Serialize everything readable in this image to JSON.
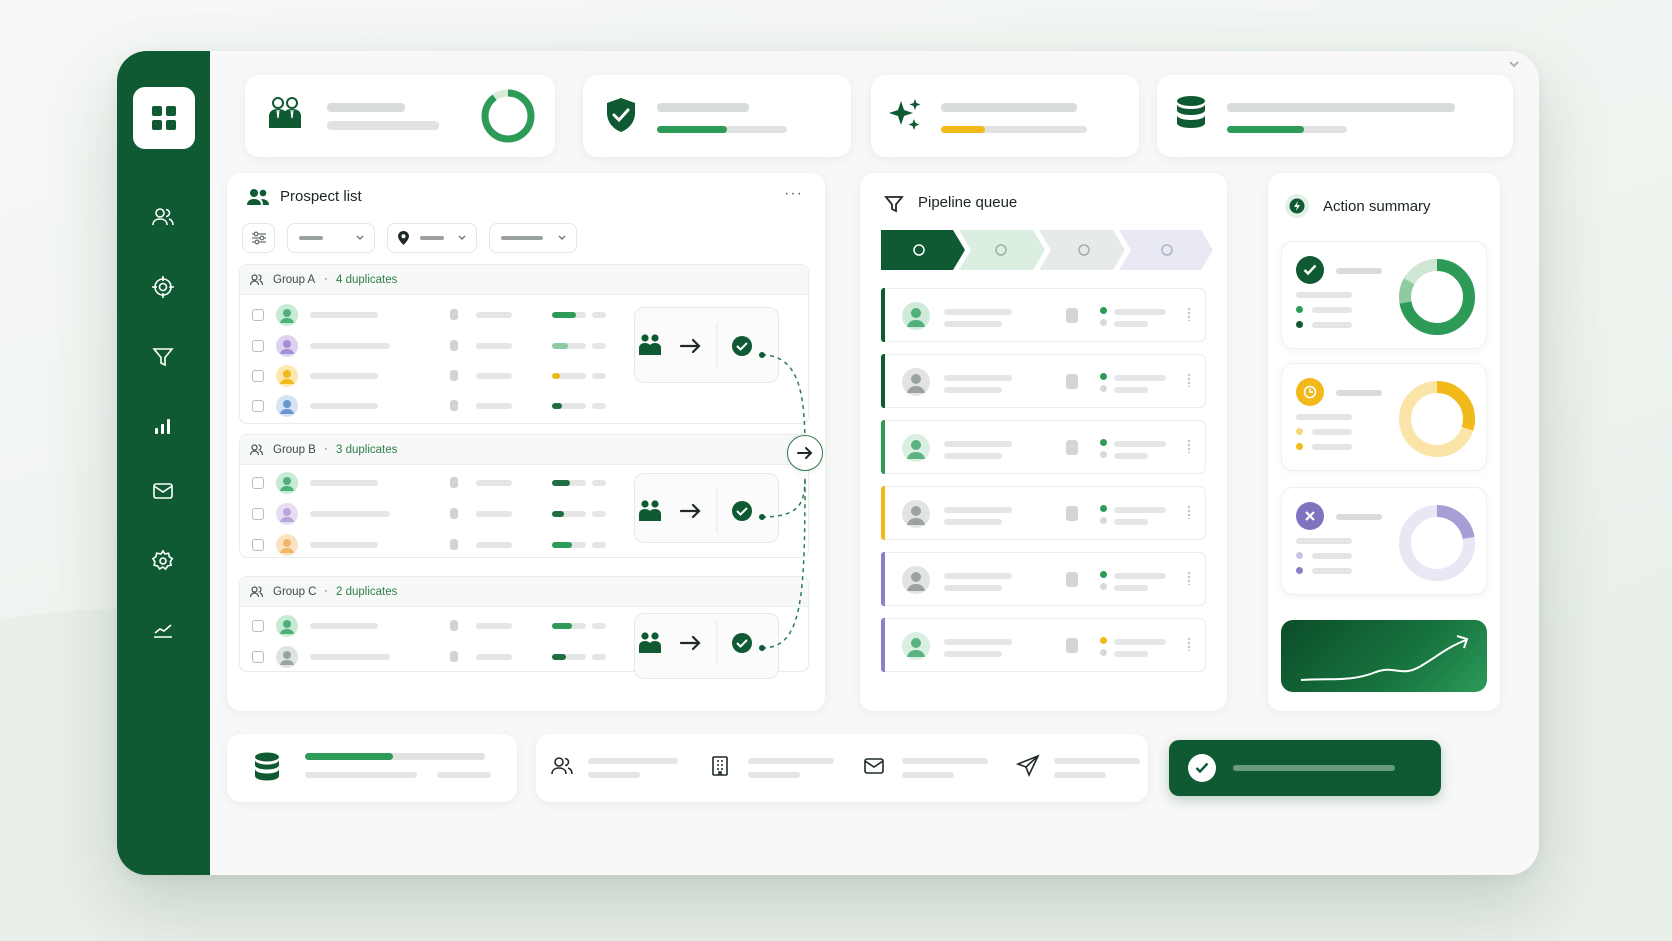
{
  "prospect_list": {
    "title": "Prospect list",
    "more": "···",
    "groups": [
      {
        "label": "Group A",
        "sep": "·",
        "count": "4 duplicates"
      },
      {
        "label": "Group B",
        "sep": "·",
        "count": "3 duplicates"
      },
      {
        "label": "Group C",
        "sep": "·",
        "count": "2 duplicates"
      }
    ]
  },
  "pipeline": {
    "title": "Pipeline queue"
  },
  "summary": {
    "title": "Action summary"
  },
  "colors": {
    "brand": "#0f5a32",
    "accent": "#2e9a58",
    "warning": "#f2b91b",
    "muted": "#8b7fc7"
  },
  "icons": [
    "grid-icon",
    "users-icon",
    "target-icon",
    "filter-icon",
    "bar-chart-icon",
    "mail-icon",
    "gear-icon",
    "trend-icon",
    "team-icon",
    "shield-icon",
    "sparkle-icon",
    "database-icon",
    "building-icon",
    "send-icon",
    "check-icon",
    "arrow-right-icon",
    "clock-icon",
    "close-icon",
    "map-pin-icon",
    "sliders-icon",
    "more-icon"
  ],
  "progress": {
    "summary_done": 0.72,
    "summary_pending": 0.3,
    "summary_rejected": 0.22,
    "top_shield": 0.52,
    "top_sparkle": 0.3,
    "top_database": 0.5,
    "bottom_database": 0.49
  }
}
